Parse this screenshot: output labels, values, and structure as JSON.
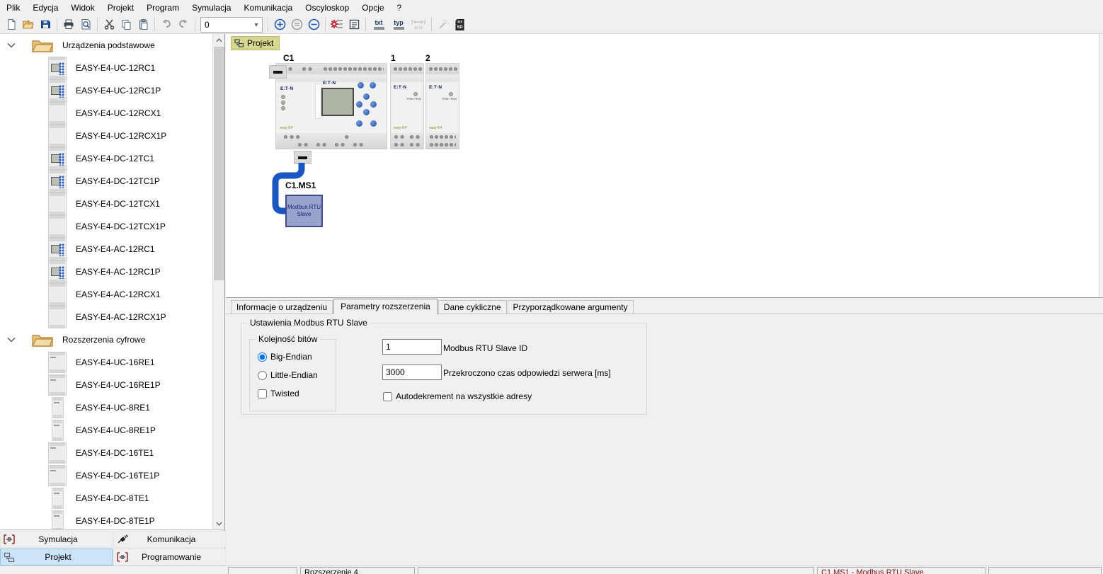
{
  "menu": {
    "items": [
      "Plik",
      "Edycja",
      "Widok",
      "Projekt",
      "Program",
      "Symulacja",
      "Komunikacja",
      "Oscyloskop",
      "Opcje",
      "?"
    ]
  },
  "toolbar": {
    "zoom_value": "0",
    "txt_label": "txt",
    "typ_label": "typ",
    "sd_label": "SD",
    "icons": [
      "new-file",
      "open-file",
      "save",
      "print",
      "print-preview",
      "cut",
      "copy",
      "paste",
      "undo",
      "redo",
      "zoom-combobox",
      "zoom-in",
      "zoom-100",
      "zoom-out",
      "cross-references",
      "remarks",
      "txt-display",
      "typ-display",
      "fit-width",
      "wand",
      "sd-card"
    ]
  },
  "sidebar": {
    "groups": [
      {
        "label": "Urządzenia podstawowe",
        "items": [
          {
            "label": "EASY-E4-UC-12RC1",
            "icon": "cpu-display"
          },
          {
            "label": "EASY-E4-UC-12RC1P",
            "icon": "cpu-display"
          },
          {
            "label": "EASY-E4-UC-12RCX1",
            "icon": "cpu-plain"
          },
          {
            "label": "EASY-E4-UC-12RCX1P",
            "icon": "cpu-plain"
          },
          {
            "label": "EASY-E4-DC-12TC1",
            "icon": "cpu-display"
          },
          {
            "label": "EASY-E4-DC-12TC1P",
            "icon": "cpu-display"
          },
          {
            "label": "EASY-E4-DC-12TCX1",
            "icon": "cpu-plain"
          },
          {
            "label": "EASY-E4-DC-12TCX1P",
            "icon": "cpu-plain"
          },
          {
            "label": "EASY-E4-AC-12RC1",
            "icon": "cpu-display"
          },
          {
            "label": "EASY-E4-AC-12RC1P",
            "icon": "cpu-display"
          },
          {
            "label": "EASY-E4-AC-12RCX1",
            "icon": "cpu-plain"
          },
          {
            "label": "EASY-E4-AC-12RCX1P",
            "icon": "cpu-plain"
          }
        ]
      },
      {
        "label": "Rozszerzenia cyfrowe",
        "items": [
          {
            "label": "EASY-E4-UC-16RE1",
            "icon": "ext-wide"
          },
          {
            "label": "EASY-E4-UC-16RE1P",
            "icon": "ext-wide"
          },
          {
            "label": "EASY-E4-UC-8RE1",
            "icon": "ext-narrow"
          },
          {
            "label": "EASY-E4-UC-8RE1P",
            "icon": "ext-narrow"
          },
          {
            "label": "EASY-E4-DC-16TE1",
            "icon": "ext-wide"
          },
          {
            "label": "EASY-E4-DC-16TE1P",
            "icon": "ext-wide"
          },
          {
            "label": "EASY-E4-DC-8TE1",
            "icon": "ext-narrow"
          },
          {
            "label": "EASY-E4-DC-8TE1P",
            "icon": "ext-narrow"
          }
        ]
      }
    ]
  },
  "canvas": {
    "tab_label": "Projekt",
    "base_label": "C1",
    "exp1_label": "1",
    "exp2_label": "2",
    "brand": "E:T·N",
    "device_sub": "easy-E4",
    "pow_run": "POW / RUN",
    "block": {
      "title": "C1.MS1",
      "line1": "Modbus RTU",
      "line2": "Slave"
    }
  },
  "details": {
    "tabs": [
      {
        "label": "Informacje o urządzeniu",
        "active": false
      },
      {
        "label": "Parametry rozszerzenia",
        "active": true
      },
      {
        "label": "Dane cykliczne",
        "active": false
      },
      {
        "label": "Przyporządkowane argumenty",
        "active": false
      }
    ],
    "group_title": "Ustawienia Modbus RTU Slave",
    "bit_order": {
      "title": "Kolejność bitów",
      "big_endian": {
        "label": "Big-Endian",
        "checked": true
      },
      "little_endian": {
        "label": "Little-Endian",
        "checked": false
      },
      "twisted": {
        "label": "Twisted",
        "checked": false
      }
    },
    "slave_id": {
      "value": "1",
      "label": "Modbus RTU Slave ID"
    },
    "timeout": {
      "value": "3000",
      "label": "Przekroczono czas odpowiedzi serwera [ms]"
    },
    "autodecrement": {
      "label": "Autodekrement na wszystkie adresy",
      "checked": false
    }
  },
  "view_switcher": {
    "buttons": [
      {
        "label": "Symulacja",
        "icon": "simulation-icon",
        "active": false
      },
      {
        "label": "Komunikacja",
        "icon": "communication-icon",
        "active": false
      },
      {
        "label": "Projekt",
        "icon": "project-icon",
        "active": true
      },
      {
        "label": "Programowanie",
        "icon": "programming-icon",
        "active": false
      }
    ]
  },
  "statusbar": {
    "segments": [
      {
        "text": "",
        "highlight": false
      },
      {
        "text": "Rozszerzenie 4",
        "highlight": false
      },
      {
        "text": "",
        "highlight": false
      },
      {
        "text": "C1.MS1 - Modbus RTU Slave",
        "highlight": true
      },
      {
        "text": "",
        "highlight": false
      }
    ]
  },
  "colors": {
    "cable_blue": "#1857c2",
    "block_fill": "#9aa3ce",
    "block_border": "#3f4c93",
    "project_tab_bg": "#d7d78d",
    "active_view_bg": "#cce4f7",
    "status_highlight_text": "#7d0d0d",
    "save_icon_blue": "#1f4e9c",
    "folder_tan": "#e6c07c"
  }
}
